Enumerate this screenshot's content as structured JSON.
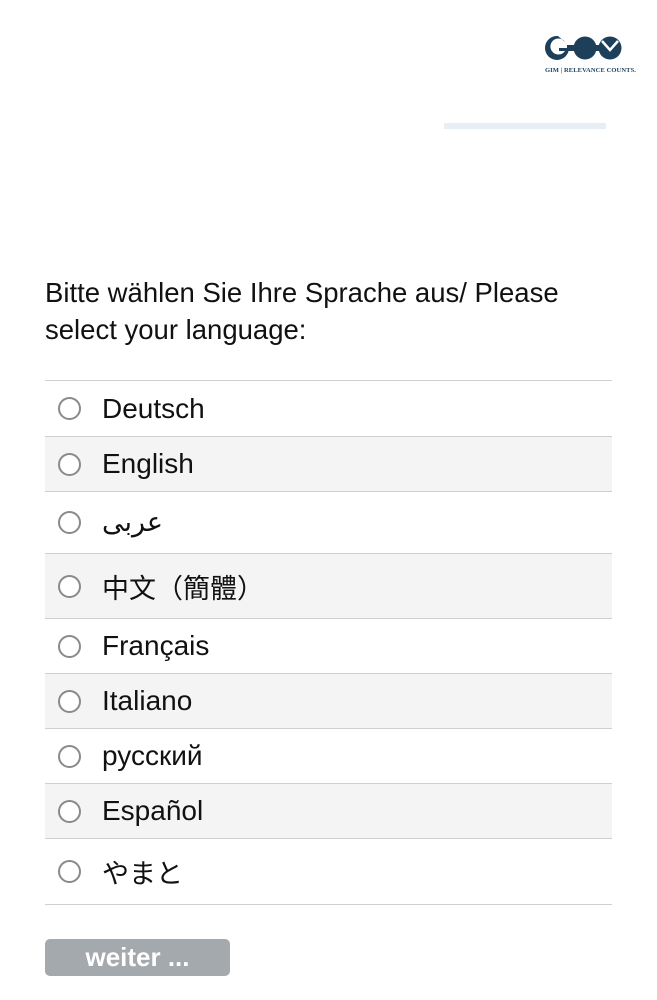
{
  "logo": {
    "tagline": "GIM | RELEVANCE COUNTS."
  },
  "colors": {
    "brand": "#1e3f5a",
    "button_bg": "#a4a9ad",
    "progress_track": "#e8eef5",
    "row_alt": "#f4f4f4",
    "divider": "#cfcfcf"
  },
  "progress": {
    "value": 0
  },
  "question": {
    "text": "Bitte wählen Sie Ihre Sprache aus/ Please select your language:"
  },
  "options": [
    {
      "label": "Deutsch"
    },
    {
      "label": "English"
    },
    {
      "label": "عربى"
    },
    {
      "label": "中文（簡體）"
    },
    {
      "label": "Français"
    },
    {
      "label": "Italiano"
    },
    {
      "label": "русский"
    },
    {
      "label": "Español"
    },
    {
      "label": "やまと"
    }
  ],
  "next_button": {
    "label": "weiter ..."
  }
}
